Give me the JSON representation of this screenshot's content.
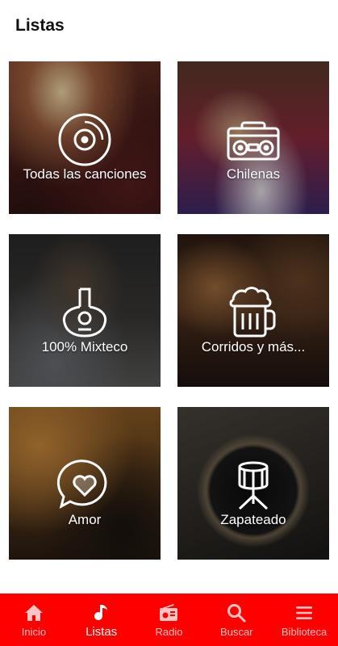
{
  "header": {
    "title": "Listas"
  },
  "tiles": [
    {
      "label": "Todas las canciones",
      "icon": "vinyl-record-icon"
    },
    {
      "label": "Chilenas",
      "icon": "boombox-icon"
    },
    {
      "label": "100% Mixteco",
      "icon": "guitar-icon"
    },
    {
      "label": "Corridos y más...",
      "icon": "beer-mug-icon"
    },
    {
      "label": "Amor",
      "icon": "heart-chat-icon"
    },
    {
      "label": "Zapateado",
      "icon": "drum-icon"
    }
  ],
  "nav": {
    "items": [
      {
        "label": "Inicio",
        "icon": "home-icon",
        "active": false
      },
      {
        "label": "Listas",
        "icon": "music-note-icon",
        "active": true
      },
      {
        "label": "Radio",
        "icon": "radio-icon",
        "active": false
      },
      {
        "label": "Buscar",
        "icon": "search-icon",
        "active": false
      },
      {
        "label": "Biblioteca",
        "icon": "menu-icon",
        "active": false
      }
    ]
  },
  "colors": {
    "accent": "#ff0000",
    "nav_inactive": "#ffc4c4",
    "nav_active": "#ffffff"
  }
}
